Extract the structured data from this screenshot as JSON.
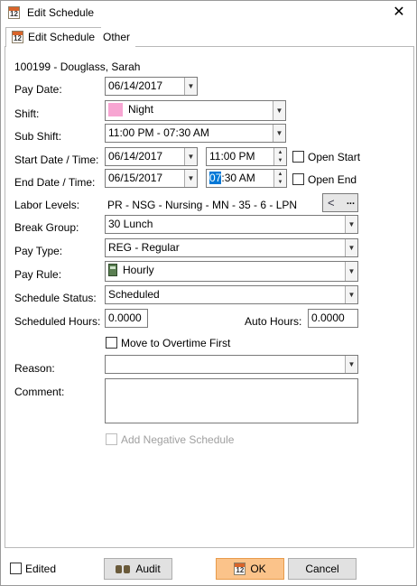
{
  "window": {
    "title": "Edit Schedule",
    "icon_text": "12"
  },
  "tabs": [
    {
      "label": "Edit Schedule"
    },
    {
      "label": "Other"
    }
  ],
  "employee": "100199 - Douglass, Sarah",
  "labels": {
    "pay_date": "Pay Date:",
    "shift": "Shift:",
    "sub_shift": "Sub Shift:",
    "start": "Start Date / Time:",
    "end": "End Date / Time:",
    "labor_levels": "Labor Levels:",
    "break_group": "Break Group:",
    "pay_type": "Pay Type:",
    "pay_rule": "Pay Rule:",
    "schedule_status": "Schedule Status:",
    "scheduled_hours": "Scheduled Hours:",
    "auto_hours": "Auto Hours:",
    "reason": "Reason:",
    "comment": "Comment:"
  },
  "values": {
    "pay_date": "06/14/2017",
    "shift": "Night",
    "shift_color": "#f7a5d2",
    "sub_shift": "11:00 PM - 07:30 AM",
    "start_date": "06/14/2017",
    "start_time": "11:00 PM",
    "end_date": "06/15/2017",
    "end_time_selected": "07",
    "end_time_rest": ":30 AM",
    "labor_levels": "PR - NSG - Nursing - MN - 35 - 6 - LPN",
    "break_group": "30 Lunch",
    "pay_type": "REG - Regular",
    "pay_rule": "Hourly",
    "schedule_status": "Scheduled",
    "scheduled_hours": "0.0000",
    "auto_hours": "0.0000",
    "reason": "",
    "comment": ""
  },
  "checkboxes": {
    "open_start": "Open Start",
    "open_end": "Open End",
    "move_to_overtime": "Move to Overtime First",
    "add_negative": "Add Negative Schedule",
    "edited": "Edited"
  },
  "buttons": {
    "audit": "Audit",
    "ok": "OK",
    "cancel": "Cancel",
    "labor_more": "..."
  },
  "icons": {
    "close": "close-icon",
    "share": "share-icon",
    "calendar": "calendar-icon",
    "binoculars": "binoculars-icon",
    "hourly": "calculator-icon"
  }
}
